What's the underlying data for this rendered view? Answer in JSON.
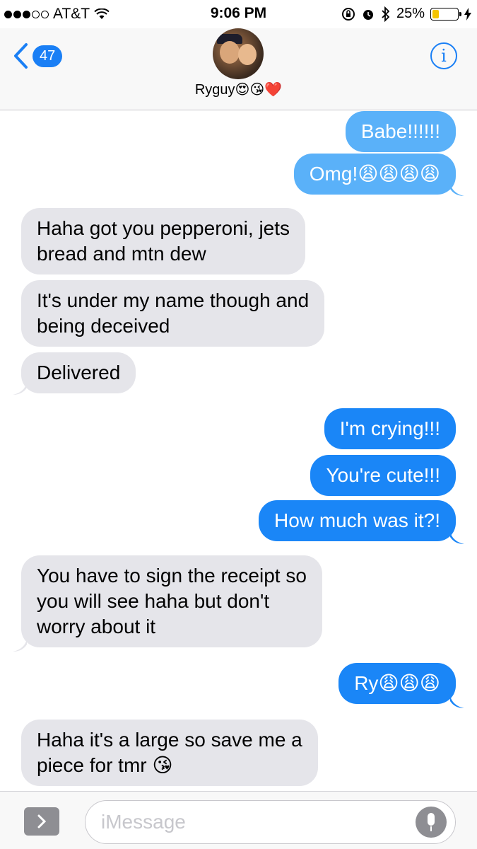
{
  "status_bar": {
    "carrier": "AT&T",
    "time": "9:06 PM",
    "battery_percent": "25%",
    "battery_level": 0.25,
    "icons": [
      "signal-dots-icon",
      "wifi-icon",
      "orientation-lock-icon",
      "alarm-icon",
      "bluetooth-icon",
      "battery-icon",
      "charging-bolt-icon"
    ]
  },
  "header": {
    "back_count": "47",
    "contact_name": "Ryguy😍😘❤️",
    "info_label": "i"
  },
  "messages": [
    {
      "dir": "out",
      "text": "Babe!!!!!!"
    },
    {
      "dir": "out",
      "text": "Omg!😩😩😩😩"
    },
    {
      "dir": "in",
      "text": "Haha got you pepperoni, jets\nbread and mtn dew"
    },
    {
      "dir": "in",
      "text": "It's under my name though and\nbeing deceived"
    },
    {
      "dir": "in",
      "text": "Delivered"
    },
    {
      "dir": "out",
      "text": "I'm crying!!!"
    },
    {
      "dir": "out",
      "text": "You're cute!!!"
    },
    {
      "dir": "out",
      "text": "How much was it?!"
    },
    {
      "dir": "in",
      "text": "You have to sign the receipt so\nyou will see haha but don't\nworry about it"
    },
    {
      "dir": "out",
      "text": "Ry😩😩😩"
    },
    {
      "dir": "in",
      "text": "Haha it's a large so save me a\npiece for tmr 😘"
    }
  ],
  "input": {
    "placeholder": "iMessage"
  },
  "colors": {
    "imessage_blue": "#1a86f7",
    "incoming_gray": "#e5e5ea",
    "link_blue": "#1a7ff5"
  }
}
